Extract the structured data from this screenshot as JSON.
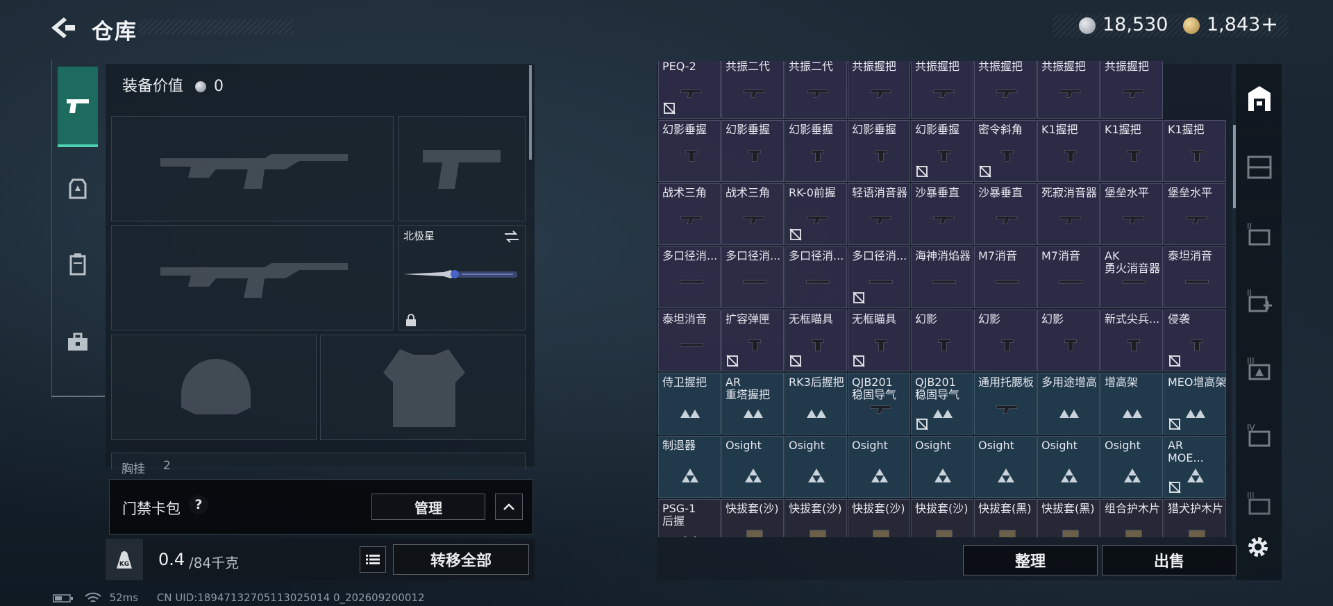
{
  "header": {
    "title": "仓库"
  },
  "currency": {
    "silver": "18,530",
    "gold": "1,843",
    "add": "+"
  },
  "equipment": {
    "value_label": "装备价值",
    "value": "0",
    "melee_name": "北极星",
    "partial_label": "胸挂",
    "partial_value": "2"
  },
  "keycard": {
    "label": "门禁卡包",
    "help": "?",
    "manage": "管理"
  },
  "weight": {
    "current": "0.4",
    "max": "/84千克",
    "transfer_all": "转移全部"
  },
  "actions": {
    "sort": "整理",
    "sell": "出售"
  },
  "status": {
    "ping": "52ms",
    "uid": "CN UID:18947132705113025014 0_202609200012"
  },
  "grid": {
    "rows": [
      [
        "PEQ-2",
        "共振二代",
        "共振二代",
        "共振握把",
        "共振握把",
        "共振握把",
        "共振握把",
        "共振握把"
      ],
      [
        "幻影垂握",
        "幻影垂握",
        "幻影垂握",
        "幻影垂握",
        "幻影垂握",
        "密令斜角",
        "K1握把",
        "K1握把",
        "K1握把"
      ],
      [
        "战术三角",
        "战术三角",
        "RK-0前握",
        "轻语消音器",
        "沙暴垂直",
        "沙暴垂直",
        "死寂消音器",
        "堡垒水平",
        "堡垒水平"
      ],
      [
        "多口径消...",
        "多口径消...",
        "多口径消...",
        "多口径消...",
        "海神消焰器",
        "M7消音",
        "M7消音",
        "AK 勇火消音器",
        "泰坦消音"
      ],
      [
        "泰坦消音",
        "扩容弹匣",
        "无框瞄具",
        "无框瞄具",
        "幻影",
        "幻影",
        "幻影",
        "新式尖兵...",
        "侵袭"
      ],
      [
        "侍卫握把",
        "AR 重塔握把",
        "RK3后握把",
        "QJB201 稳固导气",
        "QJB201 稳固导气",
        "通用托腮板",
        "多用途增高",
        "增高架",
        "MEO增高架"
      ],
      [
        "制退器",
        "Osight",
        "Osight",
        "Osight",
        "Osight",
        "Osight",
        "Osight",
        "Osight",
        "AR MOE..."
      ],
      [
        "PSG-1 后握",
        "快拔套(沙)",
        "快拔套(沙)",
        "快拔套(沙)",
        "快拔套(沙)",
        "快拔套(黑)",
        "快拔套(黑)",
        "组合护木片",
        "猎犬护木片"
      ]
    ]
  }
}
